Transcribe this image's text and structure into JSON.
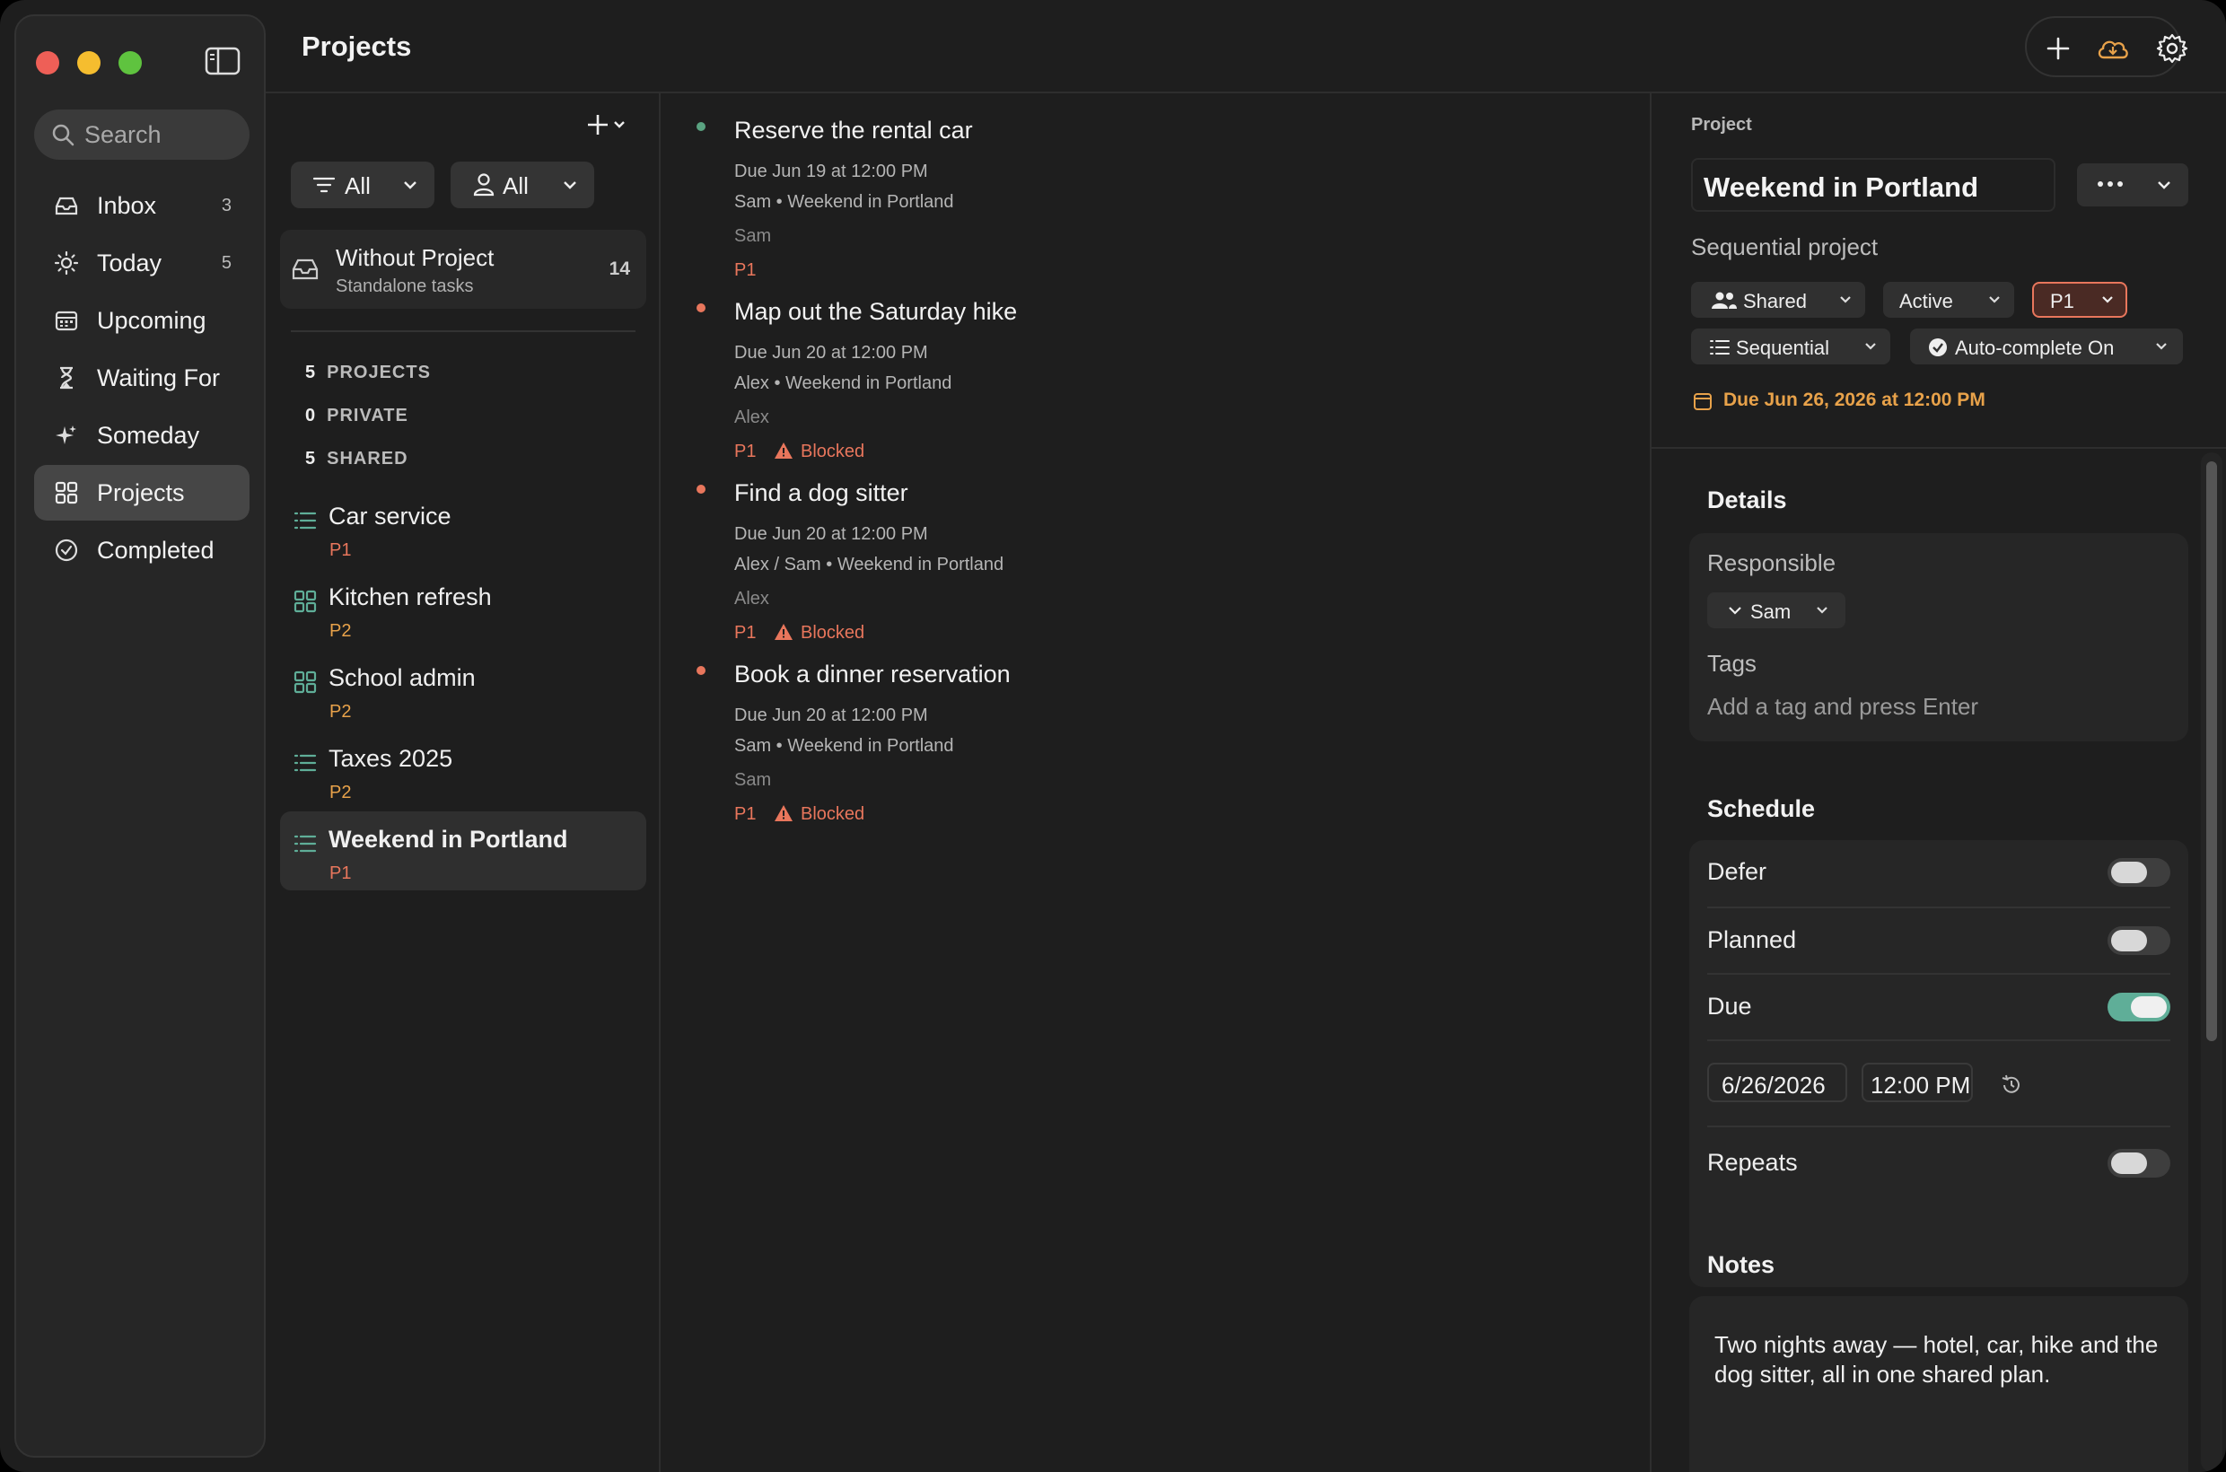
{
  "window": {
    "title": "Projects"
  },
  "colors": {
    "accent": "#5fae98",
    "p1": "#e8765c",
    "p2": "#e8a24a",
    "done_dot": "#5aa381"
  },
  "sidebar": {
    "search_placeholder": "Search",
    "items": [
      {
        "label": "Inbox",
        "count": "3",
        "icon": "inbox-icon"
      },
      {
        "label": "Today",
        "count": "5",
        "icon": "sun-icon"
      },
      {
        "label": "Upcoming",
        "count": "",
        "icon": "calendar-icon"
      },
      {
        "label": "Waiting For",
        "count": "",
        "icon": "hourglass-icon"
      },
      {
        "label": "Someday",
        "count": "",
        "icon": "sparkle-icon"
      },
      {
        "label": "Projects",
        "count": "",
        "icon": "grid-icon",
        "active": true
      },
      {
        "label": "Completed",
        "count": "",
        "icon": "check-circle-icon"
      }
    ]
  },
  "projects_pane": {
    "filter_status": "All",
    "filter_person": "All",
    "without_project": {
      "title": "Without Project",
      "subtitle": "Standalone tasks",
      "count": "14"
    },
    "stats": [
      {
        "n": "5",
        "label": "PROJECTS"
      },
      {
        "n": "0",
        "label": "PRIVATE"
      },
      {
        "n": "5",
        "label": "SHARED"
      }
    ],
    "projects": [
      {
        "name": "Car service",
        "priority": "P1",
        "icon": "list-icon"
      },
      {
        "name": "Kitchen refresh",
        "priority": "P2",
        "icon": "grid-icon"
      },
      {
        "name": "School admin",
        "priority": "P2",
        "icon": "grid-icon"
      },
      {
        "name": "Taxes 2025",
        "priority": "P2",
        "icon": "list-icon"
      },
      {
        "name": "Weekend in Portland",
        "priority": "P1",
        "icon": "list-icon",
        "selected": true
      }
    ]
  },
  "tasks": [
    {
      "title": "Reserve the rental car",
      "due": "Due Jun 19 at 12:00 PM",
      "meta": "Sam • Weekend in Portland",
      "assignee": "Sam",
      "priority": "P1",
      "blocked": ""
    },
    {
      "title": "Map out the Saturday hike",
      "due": "Due Jun 20 at 12:00 PM",
      "meta": "Alex • Weekend in Portland",
      "assignee": "Alex",
      "priority": "P1",
      "blocked": "Blocked"
    },
    {
      "title": "Find a dog sitter",
      "due": "Due Jun 20 at 12:00 PM",
      "meta": "Alex / Sam • Weekend in Portland",
      "assignee": "Alex",
      "priority": "P1",
      "blocked": "Blocked"
    },
    {
      "title": "Book a dinner reservation",
      "due": "Due Jun 20 at 12:00 PM",
      "meta": "Sam • Weekend in Portland",
      "assignee": "Sam",
      "priority": "P1",
      "blocked": "Blocked"
    }
  ],
  "inspector": {
    "kicker": "Project",
    "name": "Weekend in Portland",
    "type": "Sequential project",
    "chips": {
      "sharing": "Shared",
      "status": "Active",
      "priority": "P1",
      "ordering": "Sequential",
      "autocomplete": "Auto-complete On"
    },
    "due_line": "Due Jun 26, 2026 at 12:00 PM",
    "details_title": "Details",
    "responsible_label": "Responsible",
    "responsible_value": "Sam",
    "tags_label": "Tags",
    "tags_placeholder": "Add a tag and press Enter",
    "schedule_title": "Schedule",
    "defer_label": "Defer",
    "planned_label": "Planned",
    "due_label": "Due",
    "due_date": "6/26/2026",
    "due_time": "12:00 PM",
    "repeats_label": "Repeats",
    "notes_title": "Notes",
    "notes_text": "Two nights away — hotel, car, hike and the dog sitter, all in one shared plan."
  }
}
